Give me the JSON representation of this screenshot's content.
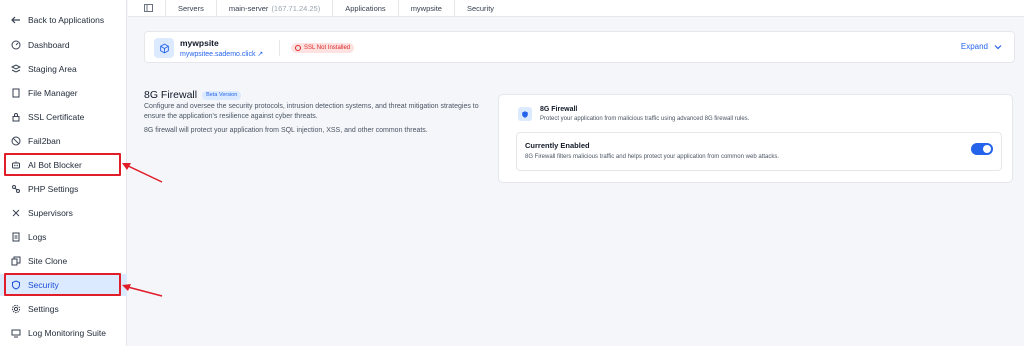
{
  "sidebar": {
    "back_label": "Back to Applications",
    "items": [
      {
        "label": "Dashboard",
        "icon": "dashboard-icon"
      },
      {
        "label": "Staging Area",
        "icon": "staging-icon"
      },
      {
        "label": "File Manager",
        "icon": "file-icon"
      },
      {
        "label": "SSL Certificate",
        "icon": "lock-icon"
      },
      {
        "label": "Fail2ban",
        "icon": "ban-icon"
      },
      {
        "label": "AI Bot Blocker",
        "icon": "robot-icon"
      },
      {
        "label": "PHP Settings",
        "icon": "php-icon"
      },
      {
        "label": "Supervisors",
        "icon": "supervisor-icon"
      },
      {
        "label": "Logs",
        "icon": "logs-icon"
      },
      {
        "label": "Site Clone",
        "icon": "clone-icon"
      },
      {
        "label": "Security",
        "icon": "shield-icon",
        "active": true
      },
      {
        "label": "Settings",
        "icon": "gear-icon"
      },
      {
        "label": "Log Monitoring Suite",
        "icon": "monitor-icon"
      }
    ]
  },
  "breadcrumb": {
    "items": [
      "Servers",
      "main-server",
      "Applications",
      "mywpsite",
      "Security"
    ],
    "server_ip": "(167.71.24.25)"
  },
  "app": {
    "name": "mywpsite",
    "domain": "mywpsitee.sademo.click",
    "ssl_status": "SSL Not Installed",
    "expand_label": "Expand"
  },
  "section": {
    "title": "8G Firewall",
    "badge": "Beta Version",
    "description": "Configure and oversee the security protocols, intrusion detection systems, and threat mitigation strategies to ensure the application's resilience against cyber threats.",
    "note": "8G firewall will protect your application from SQL injection, XSS, and other common threats."
  },
  "panel": {
    "title": "8G Firewall",
    "description": "Protect your application from malicious traffic using advanced 8G firewall rules.",
    "status_title": "Currently Enabled",
    "status_description": "8G Firewall filters malicious traffic and helps protect your application from common web attacks.",
    "enabled": true
  },
  "colors": {
    "accent": "#2563eb",
    "active_bg": "#dbeafe",
    "highlight": "#e11d2a"
  }
}
